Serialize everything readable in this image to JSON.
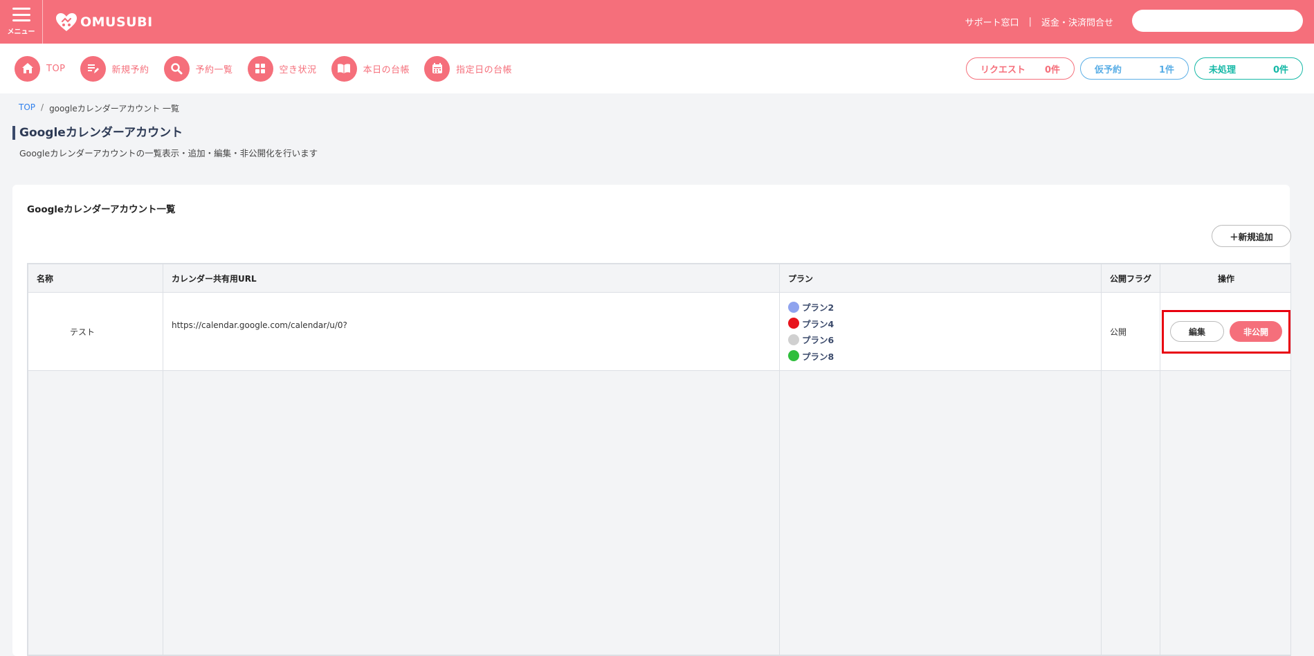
{
  "header": {
    "menu_label": "メニュー",
    "logo_text": "OMUSUBI",
    "links": [
      "サポート窓口",
      "返金・決済問合せ"
    ],
    "link_separator": "|",
    "search_placeholder": ""
  },
  "nav": {
    "items": [
      {
        "label": "TOP",
        "icon": "home-icon"
      },
      {
        "label": "新規予約",
        "icon": "edit-icon"
      },
      {
        "label": "予約一覧",
        "icon": "search-icon"
      },
      {
        "label": "空き状況",
        "icon": "grid-icon"
      },
      {
        "label": "本日の台帳",
        "icon": "book-icon"
      },
      {
        "label": "指定日の台帳",
        "icon": "calendar-icon"
      }
    ],
    "pills": [
      {
        "label": "リクエスト",
        "count": "0件",
        "color": "#f56f7b"
      },
      {
        "label": "仮予約",
        "count": "1件",
        "color": "#5aaee6"
      },
      {
        "label": "未処理",
        "count": "0件",
        "color": "#14b8a6"
      }
    ]
  },
  "breadcrumb": {
    "home": "TOP",
    "separator": "/",
    "current": "googleカレンダーアカウント 一覧"
  },
  "page": {
    "title": "Googleカレンダーアカウント",
    "description": "Googleカレンダーアカウントの一覧表示・追加・編集・非公開化を行います"
  },
  "card": {
    "title": "Googleカレンダーアカウント一覧",
    "add_button": "＋新規追加"
  },
  "table": {
    "headers": [
      "名称",
      "カレンダー共有用URL",
      "プラン",
      "公開フラグ",
      "操作"
    ],
    "rows": [
      {
        "name": "テスト",
        "url": "https://calendar.google.com/calendar/u/0?",
        "plans": [
          {
            "label": "プラン2",
            "color": "#8fa3ee"
          },
          {
            "label": "プラン4",
            "color": "#e8141d"
          },
          {
            "label": "プラン6",
            "color": "#d0d0d0"
          },
          {
            "label": "プラン8",
            "color": "#2fbe3c"
          }
        ],
        "flag": "公開",
        "edit_label": "編集",
        "unpublish_label": "非公開"
      }
    ]
  },
  "colors": {
    "brand": "#f56f7b",
    "highlight": "#e8000f"
  }
}
